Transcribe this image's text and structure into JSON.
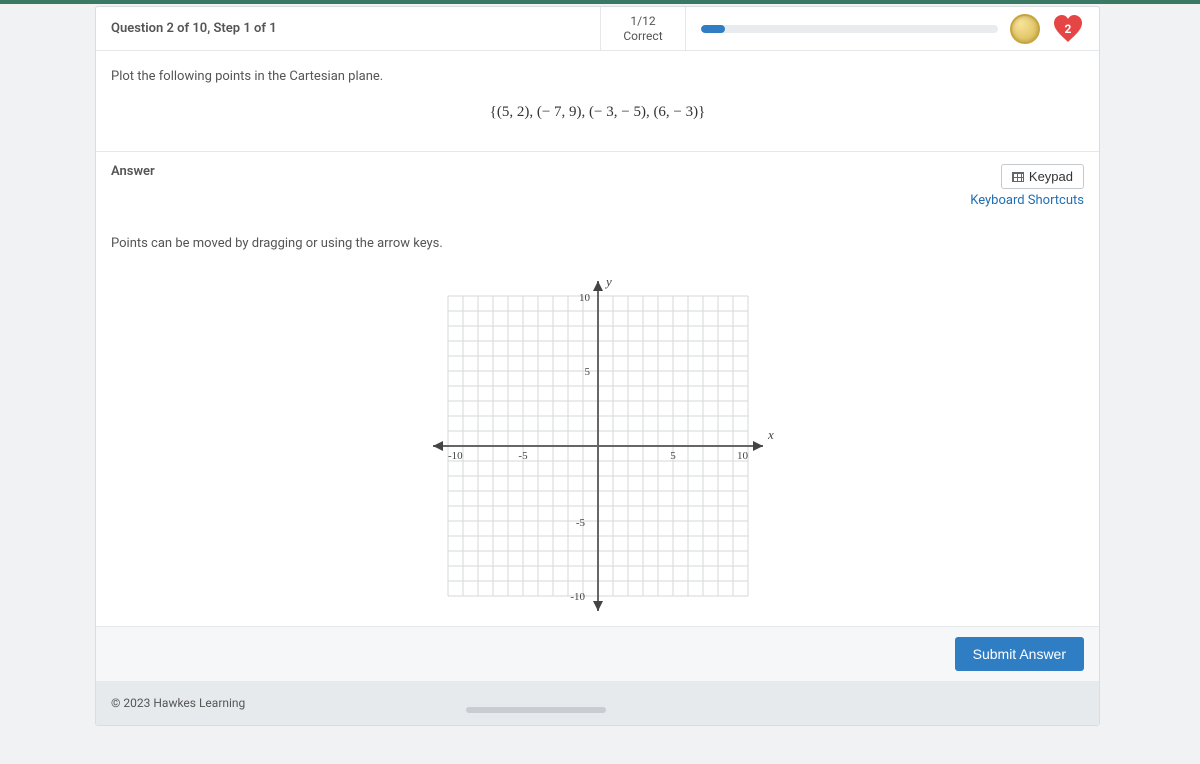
{
  "header": {
    "question_label": "Question 2 of 10, Step 1 of 1",
    "score_top": "1/12",
    "score_bottom": "Correct",
    "hearts": "2"
  },
  "question": {
    "instruction": "Plot the following points in the Cartesian plane.",
    "points_set": "{(5, 2), (− 7, 9), (− 3, − 5), (6, − 3)}"
  },
  "answer": {
    "label": "Answer",
    "keypad": "Keypad",
    "shortcuts": "Keyboard Shortcuts",
    "hint": "Points can be moved by dragging or using the arrow keys."
  },
  "chart_data": {
    "type": "scatter",
    "title": "",
    "xlabel": "x",
    "ylabel": "y",
    "xlim": [
      -10,
      10
    ],
    "ylim": [
      -10,
      10
    ],
    "ticks": {
      "x": [
        -10,
        -5,
        5,
        10
      ],
      "y": [
        -10,
        -5,
        5,
        10
      ]
    },
    "series": [
      {
        "name": "points",
        "values": []
      }
    ]
  },
  "footer": {
    "submit": "Submit Answer",
    "copyright": "© 2023 Hawkes Learning"
  }
}
